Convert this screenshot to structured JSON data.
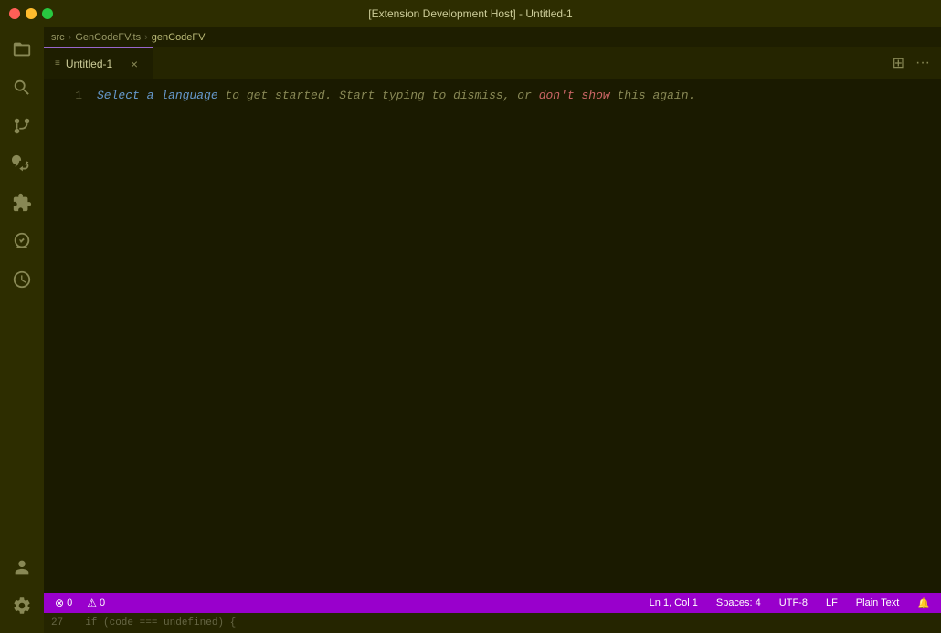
{
  "titleBar": {
    "title": "[Extension Development Host] - Untitled-1"
  },
  "breadcrumb": {
    "items": [
      "src",
      "GenCodeFV.ts",
      "genCodeFV"
    ]
  },
  "tab": {
    "name": "Untitled-1",
    "icon": "≡",
    "close": "×"
  },
  "editor": {
    "lineNumbers": [
      "1"
    ],
    "hintLine": "Select a language to get started. Start typing to dismiss, or don't show this again.",
    "hintParts": {
      "before": "",
      "select": "Select a language",
      "middle": " to get started. Start typing to dismiss, or ",
      "dont": "don't show",
      "after": " this again."
    }
  },
  "statusBar": {
    "errors": "0",
    "warnings": "0",
    "position": "Ln 1, Col 1",
    "spaces": "Spaces: 4",
    "encoding": "UTF-8",
    "lineEnding": "LF",
    "language": "Plain Text",
    "errorIcon": "⊗",
    "warningIcon": "⚠"
  },
  "bottomHint": {
    "code": "if (code === undefined) {"
  },
  "activityBar": {
    "icons": [
      {
        "name": "explorer",
        "symbol": "files"
      },
      {
        "name": "search",
        "symbol": "search"
      },
      {
        "name": "source-control",
        "symbol": "scm"
      },
      {
        "name": "run-debug",
        "symbol": "debug"
      },
      {
        "name": "extensions",
        "symbol": "extensions"
      },
      {
        "name": "remote-explorer",
        "symbol": "remote"
      },
      {
        "name": "timeline",
        "symbol": "timeline"
      }
    ]
  }
}
